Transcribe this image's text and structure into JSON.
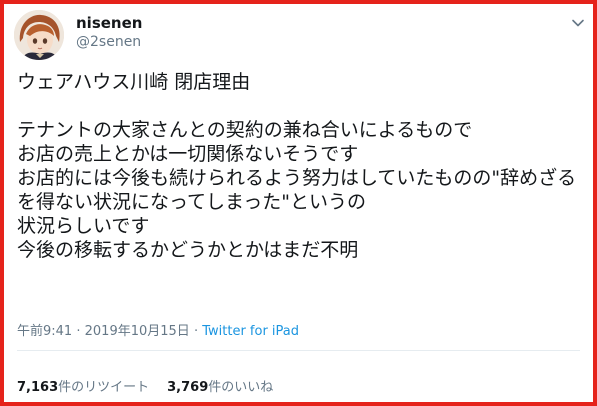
{
  "frame": {
    "border_color": "#e5231b"
  },
  "user": {
    "display_name": "nisenen",
    "handle": "@2senen",
    "avatar_icon": "anime-avatar-icon"
  },
  "tweet": {
    "text": "ウェアハウス川崎 閉店理由\n\nテナントの大家さんとの契約の兼ね合いによるもので\nお店の売上とかは一切関係ないそうです\nお店的には今後も続けられるよう努力はしていたものの\"辞めざるを得ない状況になってしまった\"というの\n状況らしいです\n今後の移転するかどうかとかはまだ不明",
    "time": "午前9:41",
    "separator": "·",
    "date": "2019年10月15日",
    "client": "Twitter for iPad"
  },
  "stats": {
    "retweets_count": "7,163",
    "retweets_label": "件のリツイート",
    "likes_count": "3,769",
    "likes_label": "件のいいね"
  },
  "colors": {
    "text": "#14171a",
    "secondary": "#657786",
    "link": "#1b95e0"
  }
}
